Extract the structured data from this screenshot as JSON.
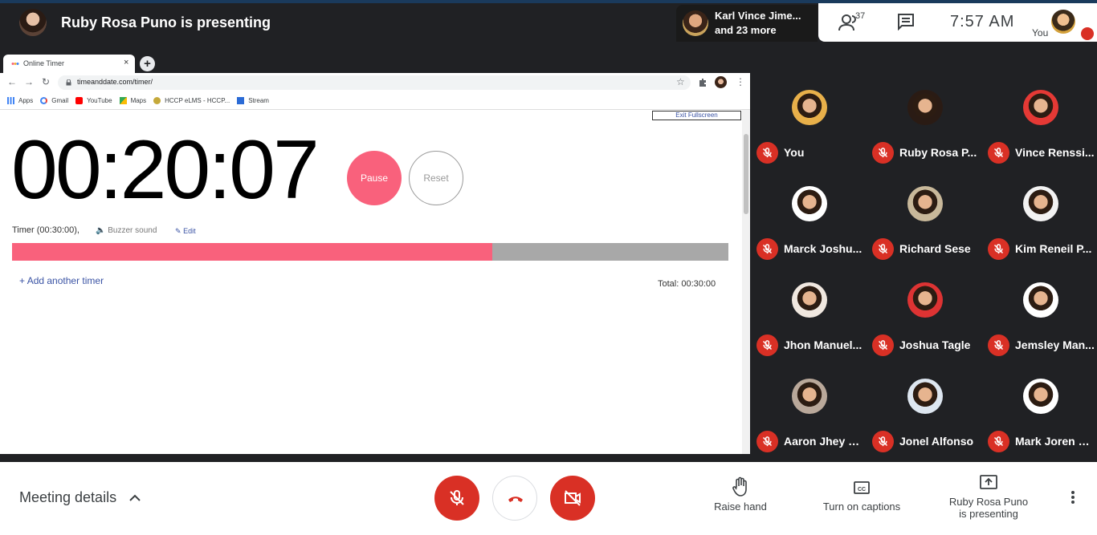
{
  "header": {
    "presenter_title": "Ruby Rosa Puno is presenting",
    "others_line1": "Karl Vince Jime...",
    "others_line2": "and 23 more",
    "people_count": "37",
    "clock": "7:57  AM",
    "self_label": "You"
  },
  "browser": {
    "tab_title": "Online Timer",
    "tab_close": "×",
    "new_tab": "+",
    "url": "timeanddate.com/timer/",
    "bookmarks": [
      {
        "label": "Apps",
        "icon": "apps-grid-icon",
        "color": "#4285f4"
      },
      {
        "label": "Gmail",
        "icon": "google-g-icon",
        "color": "#ea4335"
      },
      {
        "label": "YouTube",
        "icon": "youtube-icon",
        "color": "#ff0000"
      },
      {
        "label": "Maps",
        "icon": "maps-icon",
        "color": "#34a853"
      },
      {
        "label": "HCCP eLMS - HCCP...",
        "icon": "hccp-icon",
        "color": "#c5a93b"
      },
      {
        "label": "Stream",
        "icon": "stream-icon",
        "color": "#2b6bd6"
      }
    ]
  },
  "timer_page": {
    "exit_fullscreen": "Exit Fullscreen",
    "time": "00:20:07",
    "pause": "Pause",
    "reset": "Reset",
    "timer_label": "Timer (00:30:00),",
    "buzzer": "Buzzer  sound",
    "edit": "Edit",
    "progress_fraction": 0.67,
    "add_timer": "Add another timer",
    "total": "Total: 00:30:00"
  },
  "participants": [
    {
      "name": "You",
      "avatar_bg": "#e8b04a"
    },
    {
      "name": "Ruby Rosa P...",
      "avatar_bg": "#2a1b14"
    },
    {
      "name": "Vince Renssi...",
      "avatar_bg": "#e53935"
    },
    {
      "name": "Marck Joshu...",
      "avatar_bg": "#ffffff"
    },
    {
      "name": "Richard Sese",
      "avatar_bg": "#c8b89a"
    },
    {
      "name": "Kim Reneil P...",
      "avatar_bg": "#f2f2f2"
    },
    {
      "name": "Jhon Manuel...",
      "avatar_bg": "#f0e8e0"
    },
    {
      "name": "Joshua Tagle",
      "avatar_bg": "#d33"
    },
    {
      "name": "Jemsley Man...",
      "avatar_bg": "#ffffff"
    },
    {
      "name": "Aaron Jhey H...",
      "avatar_bg": "#b9a89a"
    },
    {
      "name": "Jonel Alfonso",
      "avatar_bg": "#dde6f0"
    },
    {
      "name": "Mark Joren G...",
      "avatar_bg": "#ffffff"
    }
  ],
  "bottom": {
    "meeting_details": "Meeting details",
    "raise_hand": "Raise hand",
    "captions": "Turn on captions",
    "presenting_line1": "Ruby Rosa Puno",
    "presenting_line2": "is presenting"
  },
  "colors": {
    "accent_red": "#d93025",
    "timer_pink": "#f9617c",
    "progress_gray": "#a8a8a8",
    "link_blue": "#3a53a4",
    "meet_dark": "#202124"
  }
}
